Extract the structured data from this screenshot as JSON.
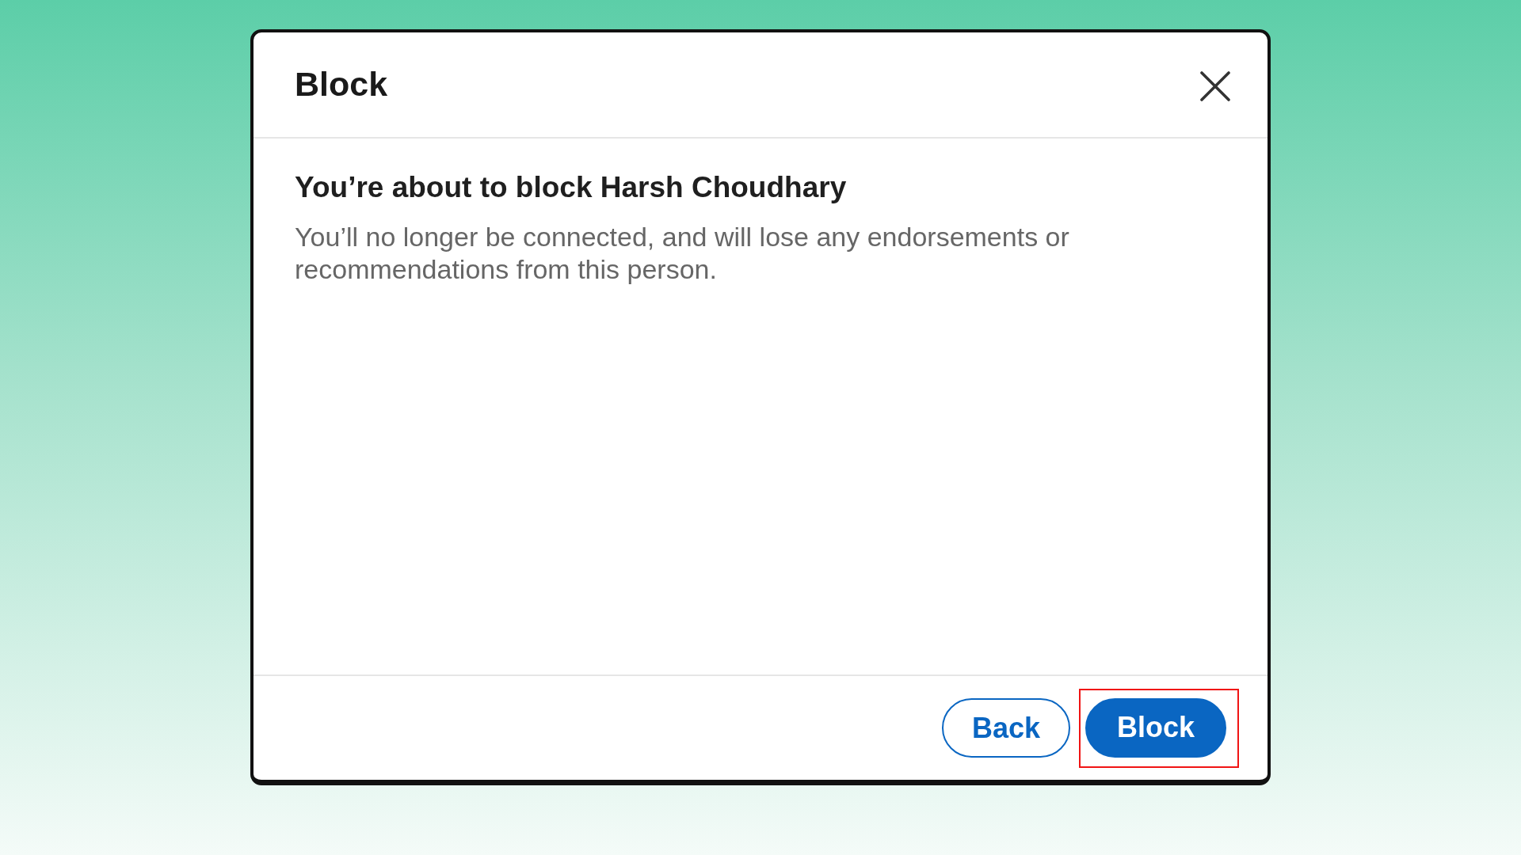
{
  "dialog": {
    "title": "Block",
    "heading": "You’re about to block Harsh Choudhary",
    "message": "You’ll no longer be connected, and will lose any endorsements or recommendations from this person.",
    "buttons": [
      {
        "label": "Back",
        "kind": "secondary",
        "highlighted": false
      },
      {
        "label": "Block",
        "kind": "primary",
        "highlighted": true
      }
    ]
  }
}
